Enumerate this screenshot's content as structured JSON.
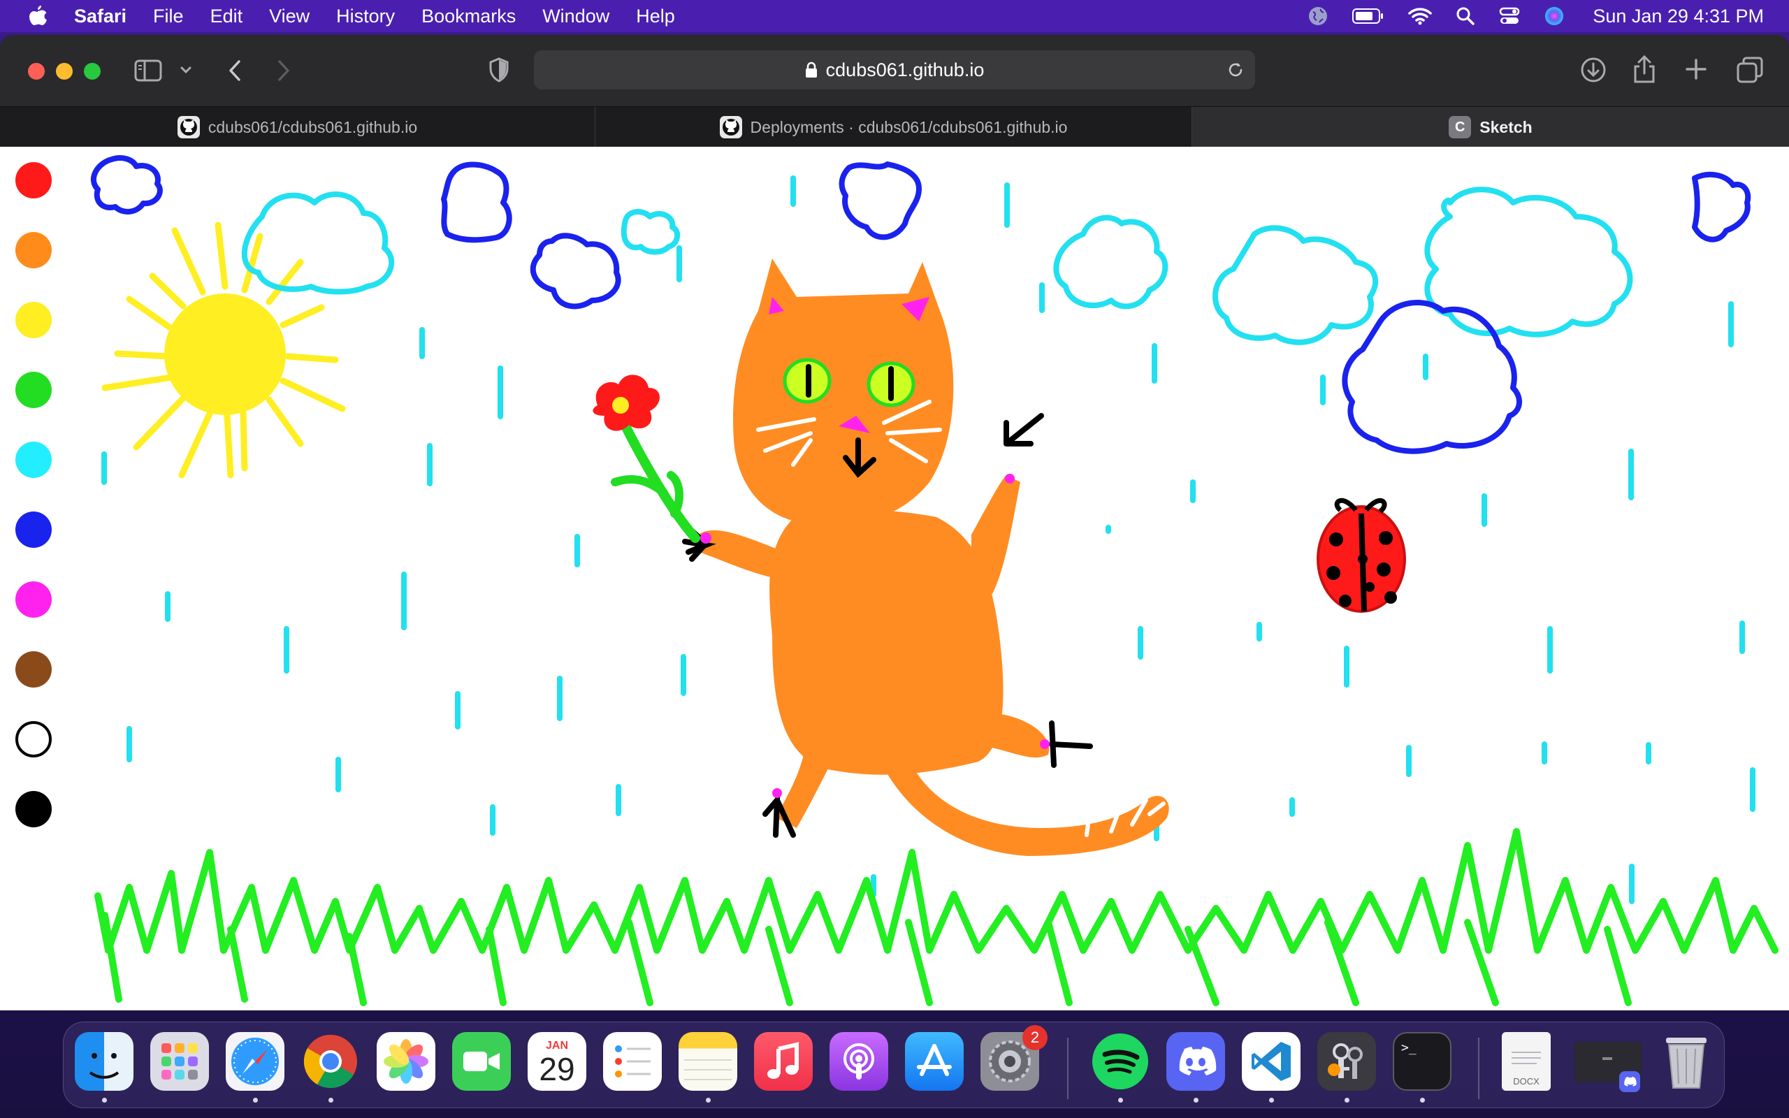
{
  "menubar": {
    "app": "Safari",
    "items": [
      "File",
      "Edit",
      "View",
      "History",
      "Bookmarks",
      "Window",
      "Help"
    ],
    "clock": "Sun Jan 29  4:31 PM",
    "status_icons": [
      "globe-icon",
      "battery-icon",
      "wifi-icon",
      "search-icon",
      "control-center-icon",
      "siri-icon"
    ]
  },
  "toolbar": {
    "url": "cdubs061.github.io"
  },
  "tabs": [
    {
      "label": "cdubs061/cdubs061.github.io",
      "icon": "github-icon"
    },
    {
      "label": "Deployments · cdubs061/cdubs061.github.io",
      "icon": "github-icon"
    },
    {
      "label": "Sketch",
      "icon_letter": "C",
      "active": true
    }
  ],
  "palette": {
    "colors": [
      "#ff1a1a",
      "#ff8c1a",
      "#ffee22",
      "#22dd22",
      "#22eeff",
      "#1a22ee",
      "#ff22ee",
      "#8b4a1a",
      "#ffffff",
      "#000000"
    ]
  },
  "dock": {
    "apps": [
      {
        "name": "Finder",
        "icon": "finder-icon"
      },
      {
        "name": "Launchpad",
        "icon": "launchpad-icon"
      },
      {
        "name": "Safari",
        "icon": "safari-icon"
      },
      {
        "name": "Chrome",
        "icon": "chrome-icon"
      },
      {
        "name": "Photos",
        "icon": "photos-icon"
      },
      {
        "name": "FaceTime",
        "icon": "facetime-icon"
      },
      {
        "name": "Calendar",
        "icon": "calendar-icon",
        "month": "JAN",
        "day": "29"
      },
      {
        "name": "Reminders",
        "icon": "reminders-icon"
      },
      {
        "name": "Notes",
        "icon": "notes-icon"
      },
      {
        "name": "Music",
        "icon": "music-icon"
      },
      {
        "name": "Podcasts",
        "icon": "podcasts-icon"
      },
      {
        "name": "App Store",
        "icon": "appstore-icon"
      },
      {
        "name": "System Preferences",
        "icon": "settings-icon",
        "badge": "2"
      },
      {
        "name": "Spotify",
        "icon": "spotify-icon"
      },
      {
        "name": "Discord",
        "icon": "discord-icon"
      },
      {
        "name": "VS Code",
        "icon": "vscode-icon"
      },
      {
        "name": "Keychain",
        "icon": "keychain-icon"
      },
      {
        "name": "Terminal",
        "icon": "terminal-icon",
        "prompt": ">_"
      }
    ],
    "docx_label": "DOCX"
  }
}
